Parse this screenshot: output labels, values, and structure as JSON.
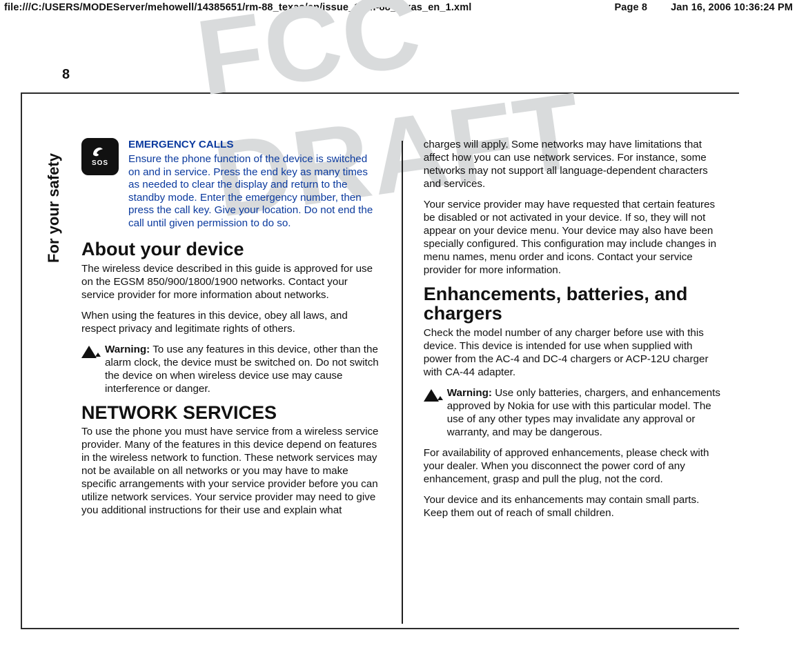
{
  "meta": {
    "path": "file:///C:/USERS/MODEServer/mehowell/14385651/rm-88_texas/en/issue_1/rm-88_texas_en_1.xml",
    "page_label": "Page 8",
    "timestamp": "Jan 16, 2006 10:36:24 PM"
  },
  "watermark": "FCC DRAFT",
  "side_title": "For your safety",
  "page_number": "8",
  "emergency": {
    "title": "EMERGENCY CALLS",
    "body": "Ensure the phone function of the device is switched on and in service. Press the end key as many times as needed to clear the display and return to the standby mode. Enter the emergency number, then press the call key. Give your location. Do not end the call until given permission to do so.",
    "sos": "SOS"
  },
  "about": {
    "heading": "About your device",
    "p1": "The wireless device described in this guide is approved for use on the EGSM 850/900/1800/1900 networks. Contact your service provider for more information about networks.",
    "p2": "When using the features in this device, obey all laws, and respect privacy and legitimate rights of others."
  },
  "warning1": {
    "label": "Warning:",
    "text": "  To use any features in this device, other than the alarm clock, the device must be switched on. Do not switch the device on when wireless device use may cause interference or danger."
  },
  "network": {
    "heading": "NETWORK SERVICES",
    "p1": "To use the phone you must have service from a wireless service provider. Many of the features in this device depend on features in the wireless network to function. These network services may not be available on all networks or you may have to make specific arrangements with your service provider before you can utilize network services. Your service provider may need to give you additional instructions for their use and explain what"
  },
  "col2": {
    "p1": "charges will apply. Some networks may have limitations that affect how you can use network services. For instance, some networks may not support all language-dependent characters and services.",
    "p2": "Your service provider may have requested that certain features be disabled or not activated in your device. If so, they will not appear on your device menu. Your device may also have been specially configured. This configuration may include changes in menu names, menu order and icons. Contact your service provider for more information."
  },
  "enhancements": {
    "heading": "Enhancements, batteries, and chargers",
    "p1": "Check the model number of any charger before use with this device. This device is intended for use when supplied with power from the AC-4 and DC-4 chargers or ACP-12U charger with CA-44 adapter."
  },
  "warning2": {
    "label": "Warning:",
    "text": "  Use only batteries, chargers, and enhancements approved by Nokia for use with this particular model. The use of any other types may invalidate any approval or warranty, and may be dangerous."
  },
  "tail": {
    "p1": "For availability of approved enhancements, please check with your dealer. When you disconnect the power cord of any enhancement, grasp and pull the plug, not the cord.",
    "p2": "Your device and its enhancements may contain small parts. Keep them out of reach of small children."
  }
}
